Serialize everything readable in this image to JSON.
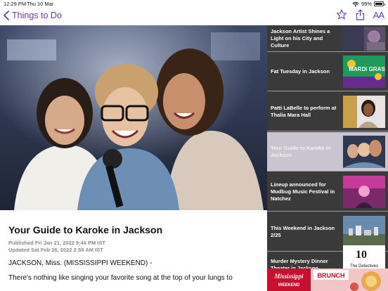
{
  "status": {
    "time": "12:29 PM",
    "date": "Thu 10 Mar",
    "battery": "99%"
  },
  "nav": {
    "back_label": "Things to Do",
    "text_size_label": "AA"
  },
  "article": {
    "headline": "Your Guide to Karoke in Jackson",
    "published": "Published Fri Jan 21, 2022 9:46 PM IST",
    "updated": "Updated Sat Feb 26, 2022 2:59 AM IST",
    "dateline": "JACKSON, Miss. (MISSISSIPPI WEEKEND) -",
    "body": "There's nothing like singing your favorite song at the top of your lungs to"
  },
  "related": {
    "items": [
      {
        "title": "Jackson Artist Shines a Light on his City and Culture",
        "active": false
      },
      {
        "title": "Fat Tuesday in Jackson",
        "active": false,
        "thumb_text": "MARDI GRAS"
      },
      {
        "title": "Patti LaBelle to perform at Thalia Mara Hall",
        "active": false
      },
      {
        "title": "Your Guide to Karoke in Jackson",
        "active": true
      },
      {
        "title": "Lineup announced for Mudbug Music Festival in Natchez",
        "active": false
      },
      {
        "title": "This Weekend in Jackson 2/25",
        "active": false
      },
      {
        "title": "Murder Mystery Dinner Theater in Jackson",
        "active": false,
        "thumb_text": "10",
        "thumb_sub": "The Detectives"
      }
    ]
  },
  "ad": {
    "brand": "Mississippi",
    "brand_sub": "WEEKEND",
    "word": "BRUNCH"
  },
  "colors": {
    "accent": "#6a3bb0",
    "panel_bg": "#3a3a3a",
    "active_item": "#c9c4cf",
    "ad_red": "#c8102e"
  }
}
